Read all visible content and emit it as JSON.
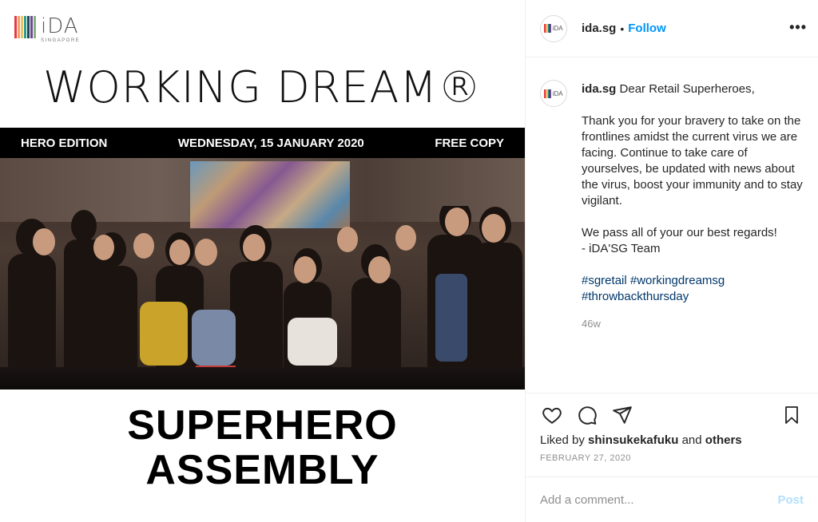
{
  "post_image": {
    "logo_word": "iDA",
    "logo_sub": "SINGAPORE",
    "logo_stripe_colors": [
      "#e63946",
      "#f4a261",
      "#e9c46a",
      "#2a9d8f",
      "#264653",
      "#6a4c93",
      "#8ab17d"
    ],
    "masthead": "WORKING DREAM®",
    "banner_left": "HERO EDITION",
    "banner_center": "WEDNESDAY, 15 JANUARY 2020",
    "banner_right": "FREE COPY",
    "headline_line1": "SUPERHERO",
    "headline_line2": "ASSEMBLY"
  },
  "header": {
    "handle": "ida.sg",
    "separator": "•",
    "follow_label": "Follow",
    "more_label": "•••",
    "avatar_word": "iDA"
  },
  "caption": {
    "handle": "ida.sg",
    "greeting": "Dear Retail Superheroes,",
    "paragraph1": "Thank you for your bravery to take on the frontlines amidst the current virus we are facing. Continue to take care of yourselves, be updated with news about the virus, boost your immunity and to stay vigilant.",
    "paragraph2_line1": "We pass all of your our best regards!",
    "paragraph2_line2": "- iDA'SG Team",
    "tags": [
      "#sgretail",
      "#workingdreamsg",
      "#throwbackthursday"
    ],
    "age": "46w"
  },
  "actions": {
    "icons": [
      "heart-icon",
      "comment-icon",
      "share-icon",
      "bookmark-icon"
    ],
    "liked_prefix": "Liked by",
    "liked_user": "shinsukekafuku",
    "liked_and": "and",
    "liked_others": "others",
    "date": "FEBRUARY 27, 2020"
  },
  "comment": {
    "placeholder": "Add a comment...",
    "post_label": "Post"
  },
  "colors": {
    "link": "#0095f6",
    "hashtag": "#00376b",
    "muted": "#8e8e8e",
    "post_disabled": "#b2dffc"
  }
}
